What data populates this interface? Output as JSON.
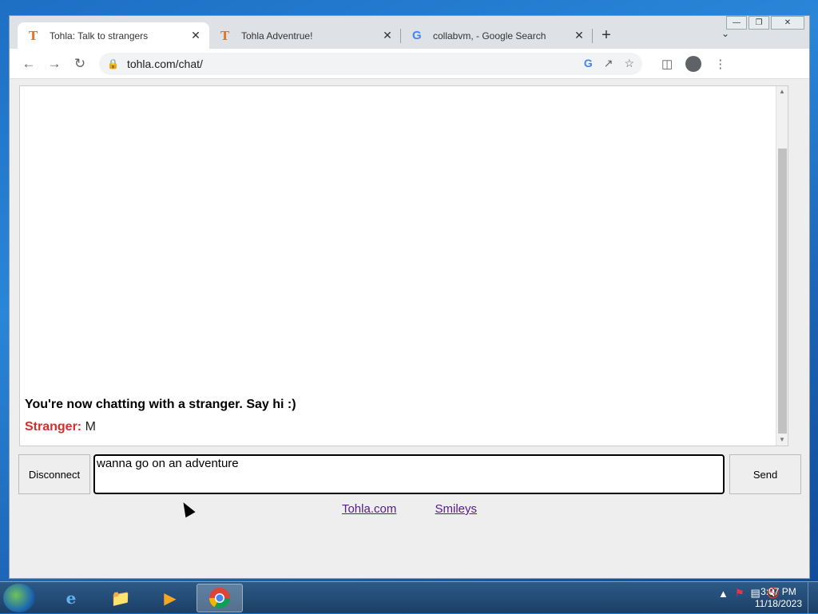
{
  "browser": {
    "tabs": [
      {
        "title": "Tohla: Talk to strangers",
        "favicon": "T",
        "active": true
      },
      {
        "title": "Tohla Adventrue!",
        "favicon": "T",
        "active": false
      },
      {
        "title": "collabvm, - Google Search",
        "favicon": "G",
        "active": false
      }
    ],
    "url": "tohla.com/chat/"
  },
  "chat": {
    "status": "You're now chatting with a stranger. Say hi :)",
    "messages": [
      {
        "sender": "Stranger:",
        "text": "M"
      }
    ],
    "input_value": "wanna go on an adventure",
    "disconnect_label": "Disconnect",
    "send_label": "Send",
    "links": [
      "Tohla.com",
      "Smileys"
    ]
  },
  "taskbar": {
    "time": "3:07 PM",
    "date": "11/18/2023"
  }
}
